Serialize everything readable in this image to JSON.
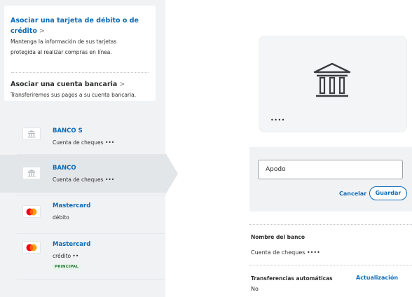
{
  "link_card": {
    "debit_title_line1": "Asociar una tarjeta de débito o de",
    "debit_title_line2": "crédito",
    "debit_desc_line1": "Mantenga la información de sus tarjetas",
    "debit_desc_line2": "protegida al realizar compras en línea.",
    "bank_title": "Asociar una cuenta bancaria",
    "bank_desc": "Transferiremos sus pagos a su cuenta bancaria.",
    "chevron": ">"
  },
  "accounts": [
    {
      "name": "BANCO S",
      "sub": "Cuenta de cheques •••",
      "icon": "bank-icon"
    },
    {
      "name": "BANCO",
      "sub": "Cuenta de cheques •••",
      "icon": "bank-icon"
    },
    {
      "name": "Mastercard",
      "sub": "débito",
      "icon": "mastercard-icon"
    },
    {
      "name": "Mastercard",
      "sub": "crédito ••",
      "icon": "mastercard-icon",
      "badge": "PRINCIPAL"
    }
  ],
  "detail": {
    "card_mask": "••••",
    "nickname_placeholder": "Apodo",
    "cancel_label": "Cancelar",
    "save_label": "Guardar",
    "bank_name_label": "Nombre del banco",
    "account_type": "Cuenta de cheques ••••",
    "auto_transfers_label": "Transferencias automáticas",
    "auto_transfers_value": "No",
    "auto_transfers_link": "Actualización"
  },
  "colors": {
    "link_blue": "#0c6ab7",
    "panel_gray": "#f1f2f4",
    "selected_gray": "#e3e6e9"
  }
}
